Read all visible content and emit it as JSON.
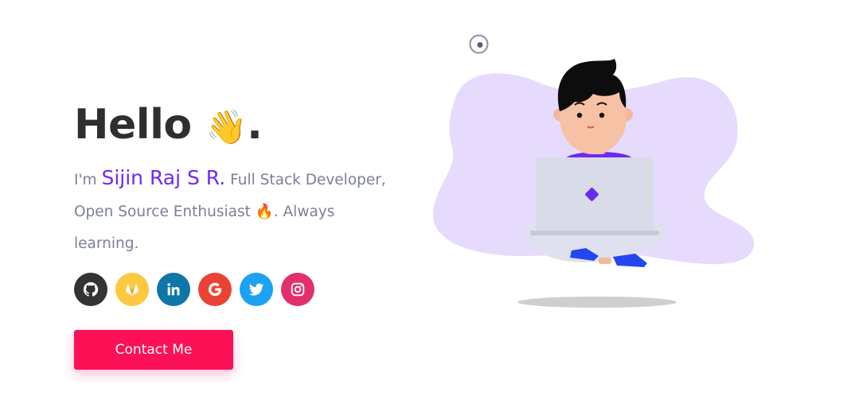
{
  "greeting": {
    "text": "Hello",
    "emoji": "👋",
    "punct": "."
  },
  "intro": {
    "prefix": "I'm ",
    "name": "Sijin Raj S R.",
    "line": " Full Stack Developer, Open Source Enthusiast ",
    "fire": "🔥",
    "suffix": ". Always learning."
  },
  "socials": [
    {
      "icon": "github-icon",
      "color": "#333333"
    },
    {
      "icon": "gitlab-icon",
      "color": "#fcc840"
    },
    {
      "icon": "linkedin-icon",
      "color": "#0e76a8"
    },
    {
      "icon": "google-icon",
      "color": "#ea4335"
    },
    {
      "icon": "twitter-icon",
      "color": "#1da1f2"
    },
    {
      "icon": "instagram-icon",
      "color": "#e1306c"
    }
  ],
  "contact": {
    "label": "Contact Me",
    "color": "#fc1056"
  },
  "colors": {
    "accent": "#6a2af4",
    "blob": "#e6dbfc",
    "text": "#7a8193"
  }
}
